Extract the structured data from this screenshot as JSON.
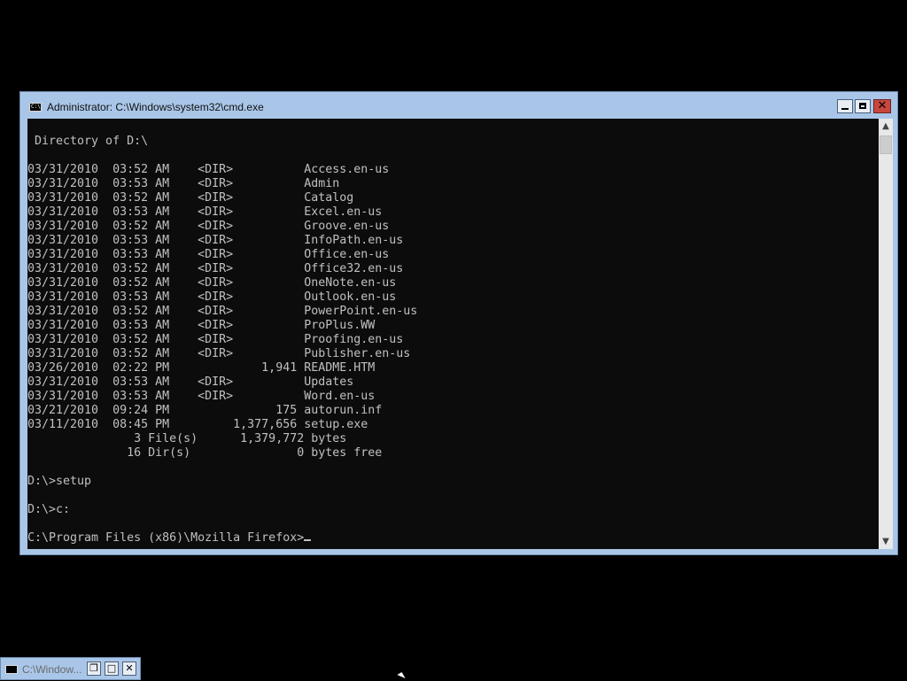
{
  "window": {
    "title": "Administrator: C:\\Windows\\system32\\cmd.exe",
    "icon": "console-icon",
    "controls": {
      "minimize": "minimize-icon",
      "maximize": "maximize-icon",
      "close": "close-icon"
    }
  },
  "console": {
    "lines": [
      " Directory of D:\\",
      "",
      "03/31/2010  03:52 AM    <DIR>          Access.en-us",
      "03/31/2010  03:53 AM    <DIR>          Admin",
      "03/31/2010  03:52 AM    <DIR>          Catalog",
      "03/31/2010  03:53 AM    <DIR>          Excel.en-us",
      "03/31/2010  03:52 AM    <DIR>          Groove.en-us",
      "03/31/2010  03:53 AM    <DIR>          InfoPath.en-us",
      "03/31/2010  03:53 AM    <DIR>          Office.en-us",
      "03/31/2010  03:52 AM    <DIR>          Office32.en-us",
      "03/31/2010  03:52 AM    <DIR>          OneNote.en-us",
      "03/31/2010  03:53 AM    <DIR>          Outlook.en-us",
      "03/31/2010  03:52 AM    <DIR>          PowerPoint.en-us",
      "03/31/2010  03:53 AM    <DIR>          ProPlus.WW",
      "03/31/2010  03:52 AM    <DIR>          Proofing.en-us",
      "03/31/2010  03:52 AM    <DIR>          Publisher.en-us",
      "03/26/2010  02:22 PM             1,941 README.HTM",
      "03/31/2010  03:53 AM    <DIR>          Updates",
      "03/31/2010  03:53 AM    <DIR>          Word.en-us",
      "03/21/2010  09:24 PM               175 autorun.inf",
      "03/11/2010  08:45 PM         1,377,656 setup.exe",
      "               3 File(s)      1,379,772 bytes",
      "              16 Dir(s)               0 bytes free",
      "",
      "D:\\>setup",
      "",
      "D:\\>c:",
      ""
    ],
    "prompt": "C:\\Program Files (x86)\\Mozilla Firefox>"
  },
  "scrollbar": {
    "up": "▲",
    "down": "▼"
  },
  "minimized_window": {
    "title": "C:\\Window...",
    "icon": "console-icon",
    "controls": {
      "restore": "restore-icon",
      "maximize": "maximize-icon",
      "close": "close-icon"
    }
  }
}
